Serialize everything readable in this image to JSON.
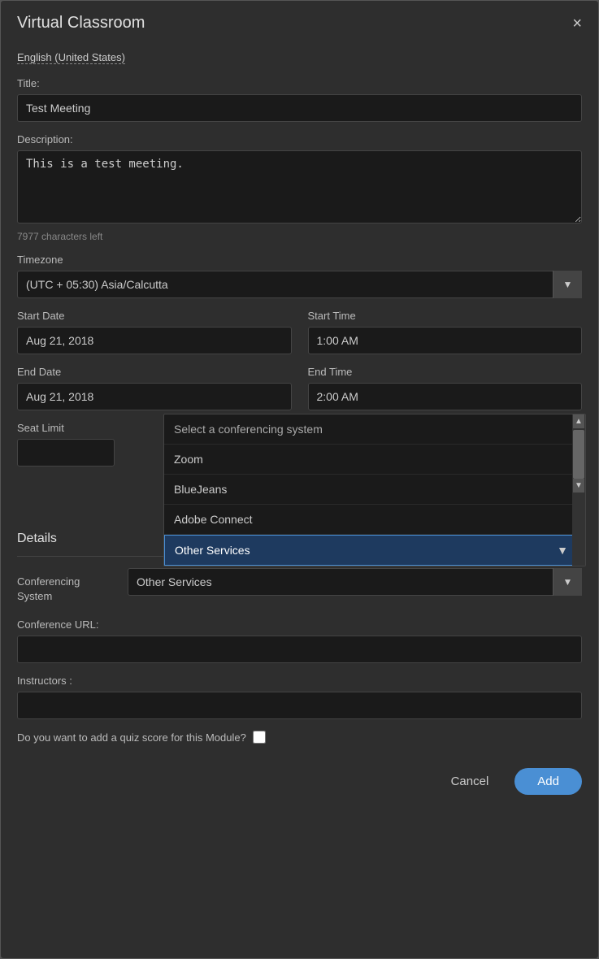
{
  "modal": {
    "title": "Virtual Classroom",
    "close_label": "×"
  },
  "language": {
    "label": "English (United States)"
  },
  "form": {
    "title_label": "Title:",
    "title_value": "Test Meeting",
    "description_label": "Description:",
    "description_value": "This is a test meeting.",
    "char_count": "7977 characters left",
    "timezone_label": "Timezone",
    "timezone_value": "(UTC + 05:30) Asia/Calcutta",
    "start_date_label": "Start Date",
    "start_date_value": "Aug 21, 2018",
    "start_time_label": "Start Time",
    "start_time_value": "1:00 AM",
    "end_date_label": "End Date",
    "end_date_value": "Aug 21, 2018",
    "end_time_label": "End Time",
    "end_time_value": "2:00 AM",
    "seat_limit_label": "Seat Limit",
    "seat_limit_value": "",
    "details_label": "Details",
    "conferencing_label": "Conferencing\nSystem",
    "conference_url_label": "Conference URL:",
    "conference_url_value": "",
    "instructors_label": "Instructors :",
    "instructors_value": "",
    "quiz_label": "Do you want to add a quiz score for this Module?"
  },
  "dropdown": {
    "placeholder": "Select a conferencing system",
    "options": [
      {
        "value": "select",
        "label": "Select a conferencing system"
      },
      {
        "value": "zoom",
        "label": "Zoom"
      },
      {
        "value": "bluejeans",
        "label": "BlueJeans"
      },
      {
        "value": "adobe_connect",
        "label": "Adobe Connect"
      },
      {
        "value": "other_services",
        "label": "Other Services"
      }
    ],
    "selected": "Other Services"
  },
  "buttons": {
    "cancel_label": "Cancel",
    "add_label": "Add"
  },
  "icons": {
    "close": "✕",
    "chevron_down": "▼",
    "scrollbar_up": "▲",
    "scrollbar_down": "▼"
  }
}
